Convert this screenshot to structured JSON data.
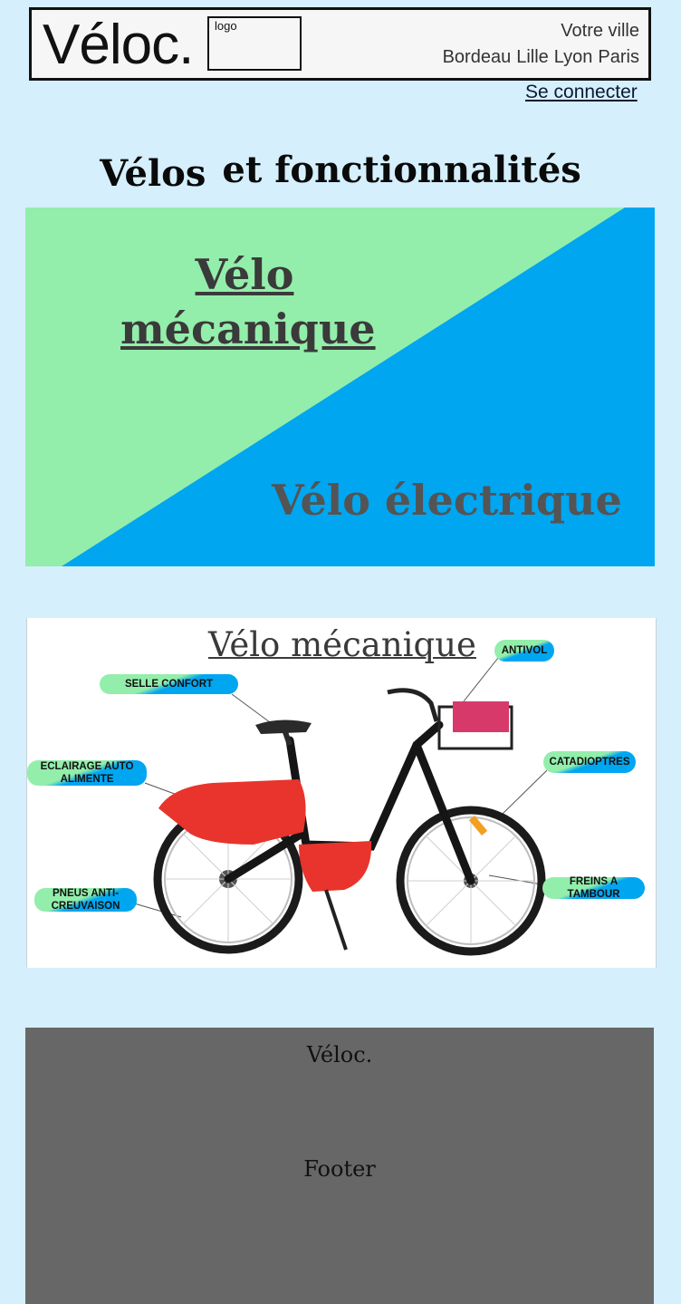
{
  "header": {
    "brand": "Véloc.",
    "logo_label": "logo",
    "city_title": "Votre ville",
    "cities": [
      "Bordeau",
      "Lille",
      "Lyon",
      "Paris"
    ],
    "login": "Se connecter"
  },
  "main": {
    "title_part1": "Vélos",
    "title_part2": "et fonctionnalités",
    "banner": {
      "mechanical_link": "Vélo mécanique",
      "electric_link": "Vélo électrique",
      "colors": {
        "green": "#93eeab",
        "blue": "#00a6f0"
      }
    },
    "bike": {
      "title": "Vélo mécanique",
      "features": {
        "antivol": "ANTIVOL",
        "selle": "SELLE CONFORT",
        "eclairage": "ECLAIRAGE AUTO ALIMENTE",
        "catadioptres": "CATADIOPTRES",
        "pneus": "PNEUS ANTI-CREUVAISON",
        "freins": "FREINS A TAMBOUR"
      }
    }
  },
  "footer": {
    "brand": "Véloc.",
    "text": "Footer"
  }
}
